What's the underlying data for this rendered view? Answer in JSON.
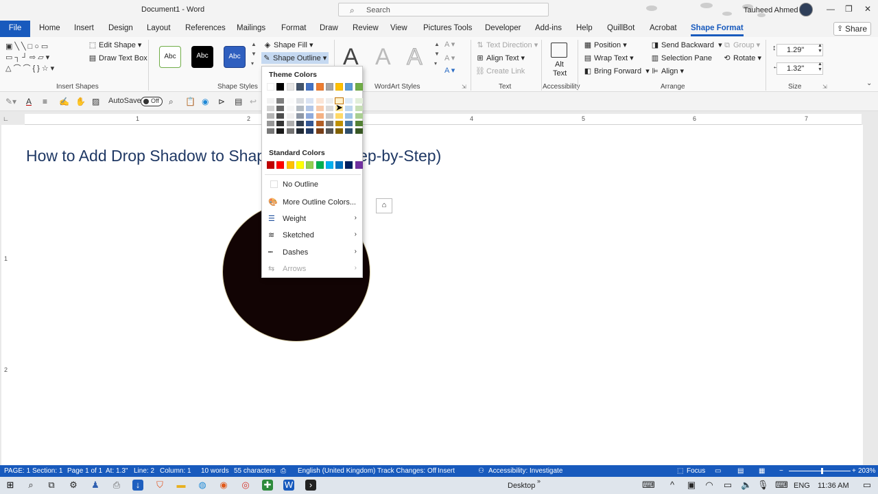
{
  "window": {
    "title": "Document1 - Word",
    "search_placeholder": "Search",
    "user_name": "Tauheed Ahmed"
  },
  "tabs": [
    {
      "label": "File"
    },
    {
      "label": "Home"
    },
    {
      "label": "Insert"
    },
    {
      "label": "Design"
    },
    {
      "label": "Layout"
    },
    {
      "label": "References"
    },
    {
      "label": "Mailings"
    },
    {
      "label": "Format"
    },
    {
      "label": "Draw"
    },
    {
      "label": "Review"
    },
    {
      "label": "View"
    },
    {
      "label": "Pictures Tools"
    },
    {
      "label": "Developer"
    },
    {
      "label": "Add-ins"
    },
    {
      "label": "Help"
    },
    {
      "label": "QuillBot"
    },
    {
      "label": "Acrobat"
    },
    {
      "label": "Shape Format"
    }
  ],
  "share_label": "Share",
  "ribbon": {
    "insert_shapes": {
      "edit_shape": "Edit Shape",
      "draw_text_box": "Draw Text Box",
      "label": "Insert Shapes"
    },
    "shape_styles": {
      "style_sample": "Abc",
      "shape_fill": "Shape Fill",
      "shape_outline": "Shape Outline",
      "label": "Shape Styles"
    },
    "wordart": {
      "letter": "A",
      "label": "WordArt Styles"
    },
    "text": {
      "text_direction": "Text Direction",
      "align_text": "Align Text",
      "create_link": "Create Link",
      "label": "Text"
    },
    "accessibility": {
      "alt_text_1": "Alt",
      "alt_text_2": "Text",
      "label": "Accessibility"
    },
    "arrange": {
      "position": "Position",
      "wrap_text": "Wrap Text",
      "bring_forward": "Bring Forward",
      "send_backward": "Send Backward",
      "selection_pane": "Selection Pane",
      "align": "Align",
      "group": "Group",
      "rotate": "Rotate",
      "label": "Arrange"
    },
    "size": {
      "height": "1.29\"",
      "width": "1.32\"",
      "label": "Size"
    }
  },
  "qat": {
    "autosave_label": "AutoSave",
    "autosave_state": "Off"
  },
  "ruler": {
    "h_numbers": [
      "1",
      "2",
      "4",
      "5",
      "6",
      "7"
    ],
    "v_numbers": [
      "1",
      "2"
    ]
  },
  "document": {
    "heading_left": "How to Add Drop Shadow to Shap",
    "heading_right": "ep-by-Step)"
  },
  "outline_menu": {
    "theme_colors_heading": "Theme Colors",
    "standard_colors_heading": "Standard Colors",
    "theme_colors": [
      "#ffffff",
      "#000000",
      "#e7e6e6",
      "#44546a",
      "#4472c4",
      "#ed7d31",
      "#a5a5a5",
      "#ffc000",
      "#5b9bd5",
      "#70ad47"
    ],
    "standard_colors": [
      "#c00000",
      "#ff0000",
      "#ffc000",
      "#ffff00",
      "#92d050",
      "#00b050",
      "#00b0f0",
      "#0070c0",
      "#002060",
      "#7030a0"
    ],
    "items": [
      {
        "label": "No Outline"
      },
      {
        "label": "More Outline Colors..."
      },
      {
        "label": "Weight"
      },
      {
        "label": "Sketched"
      },
      {
        "label": "Dashes"
      },
      {
        "label": "Arrows"
      }
    ]
  },
  "status": {
    "page": "PAGE: 1",
    "section": "Section: 1",
    "page_of": "Page 1 of 1",
    "at": "At: 1.3\"",
    "line": "Line: 2",
    "column": "Column: 1",
    "words": "10 words",
    "characters": "55 characters",
    "language": "English (United Kingdom)",
    "track_changes": "Track Changes: Off",
    "insert_mode": "Insert",
    "accessibility": "Accessibility: Investigate",
    "focus": "Focus",
    "zoom": "203%"
  },
  "taskbar": {
    "desktop_label": "Desktop",
    "language": "ENG",
    "time": "11:36 AM"
  }
}
